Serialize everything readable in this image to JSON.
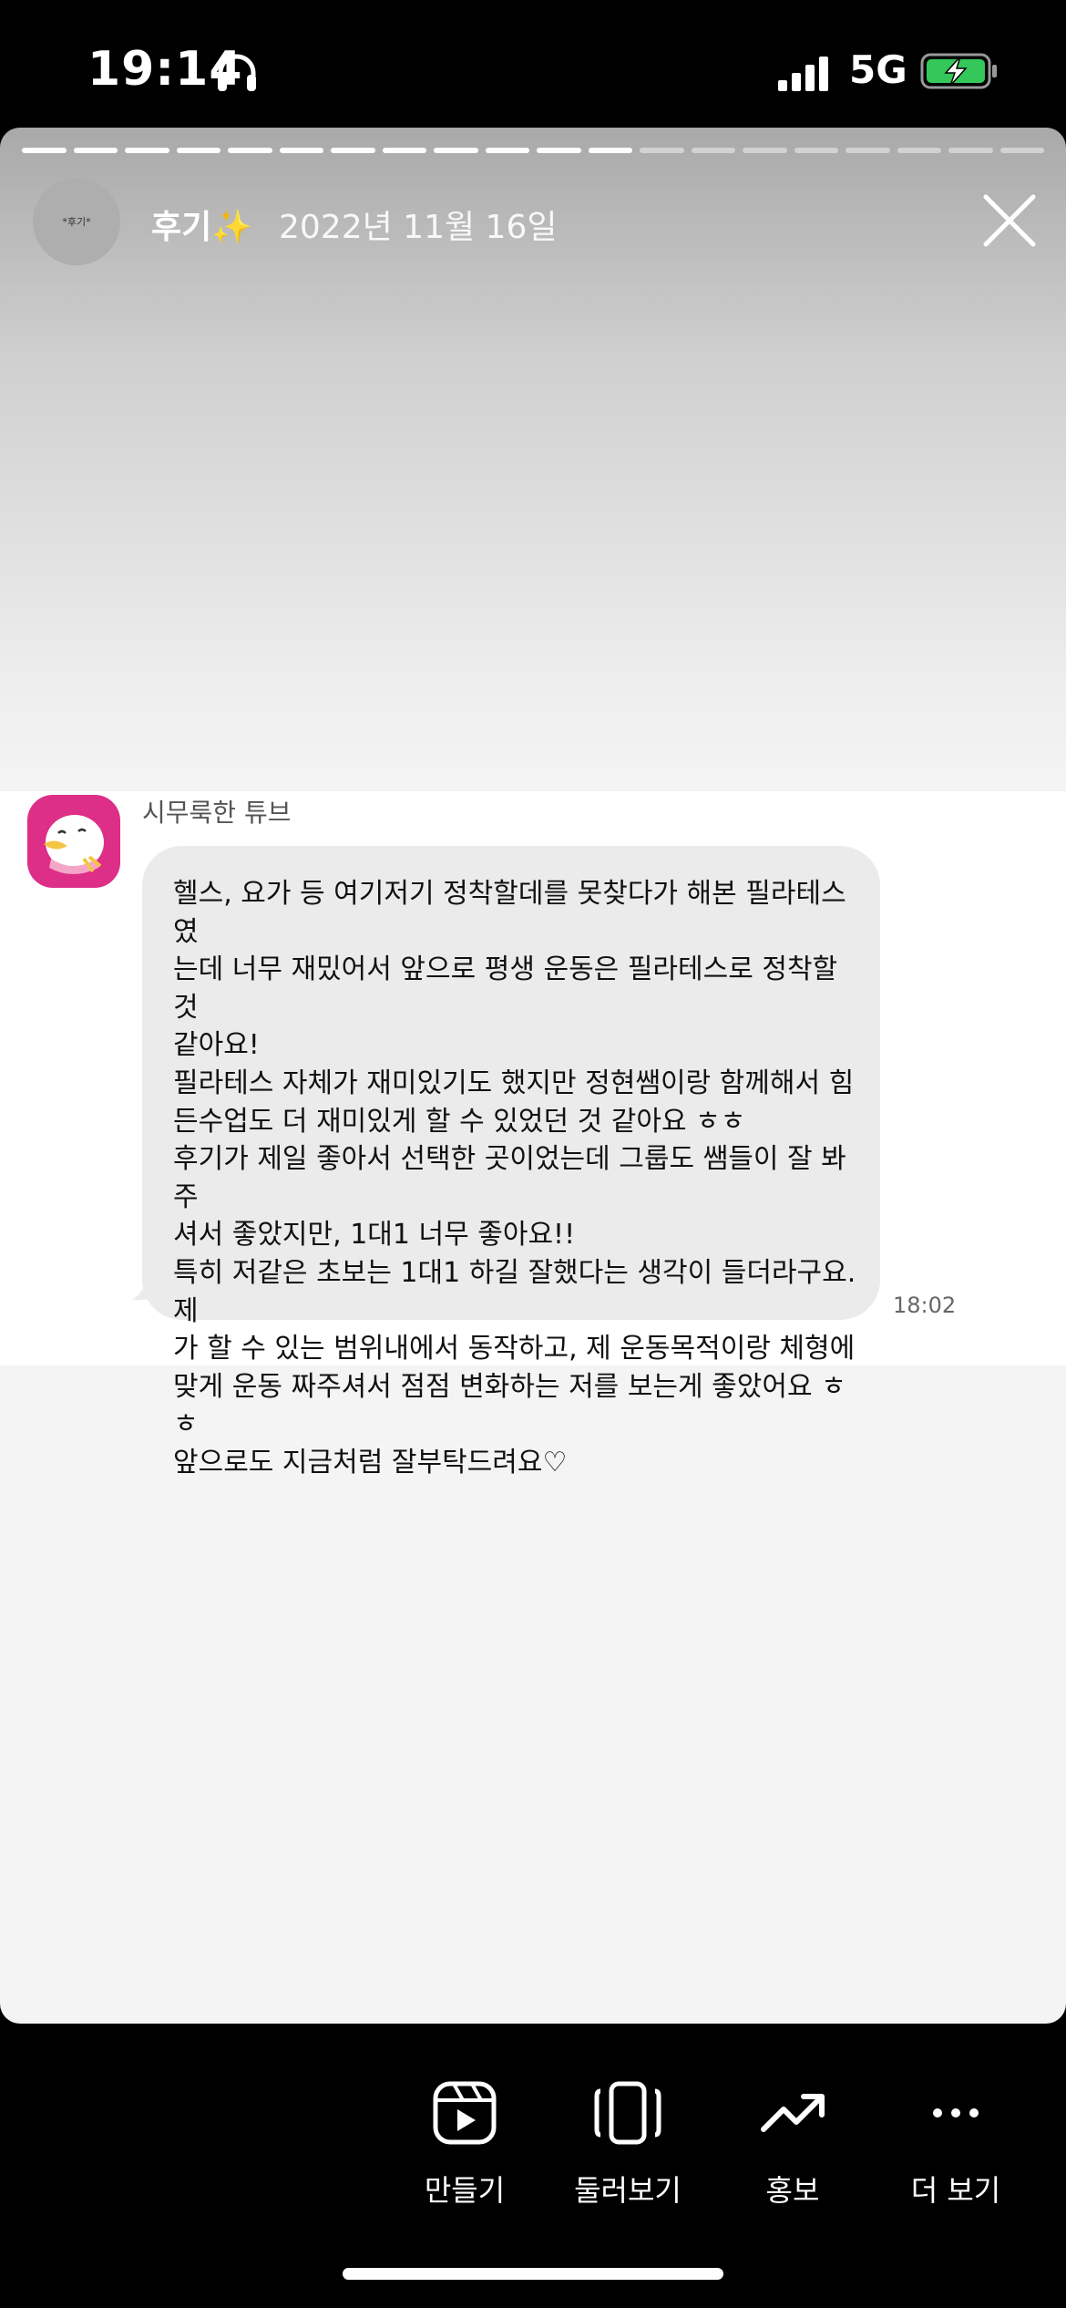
{
  "status_bar": {
    "time": "19:14",
    "network": "5G"
  },
  "story": {
    "progress": {
      "total_segments": 20,
      "completed_segments": 12
    },
    "account_avatar_text": "*후기*",
    "account_name": "후기✨",
    "date": "2022년 11월 16일"
  },
  "chat": {
    "sender": "시무룩한 튜브",
    "message": "헬스, 요가 등 여기저기 정착할데를 못찾다가 해본 필라테스였\n는데 너무 재밌어서 앞으로 평생 운동은 필라테스로 정착할것\n같아요!\n필라테스 자체가 재미있기도 했지만 정현쌤이랑 함께해서 힘\n든수업도 더 재미있게 할 수 있었던 것 같아요 ㅎㅎ\n후기가 제일 좋아서 선택한 곳이었는데 그룹도 쌤들이 잘 봐주\n셔서 좋았지만, 1대1 너무 좋아요!!\n특히 저같은 초보는 1대1 하길 잘했다는 생각이 들더라구요. 제\n가 할 수 있는 범위내에서 동작하고, 제 운동목적이랑 체형에\n맞게 운동 짜주셔서 점점 변화하는 저를 보는게 좋았어요 ㅎㅎ\n앞으로도 지금처럼 잘부탁드려요♡",
    "time": "18:02"
  },
  "toolbar": {
    "items": [
      {
        "label": "만들기",
        "icon": "reels-icon"
      },
      {
        "label": "둘러보기",
        "icon": "browse-icon"
      },
      {
        "label": "홍보",
        "icon": "trend-up-icon"
      },
      {
        "label": "더 보기",
        "icon": "more-icon"
      }
    ]
  },
  "colors": {
    "battery_fill": "#34c759",
    "chat_avatar_bg": "#dd2e88",
    "bubble_bg": "#ebebeb"
  }
}
